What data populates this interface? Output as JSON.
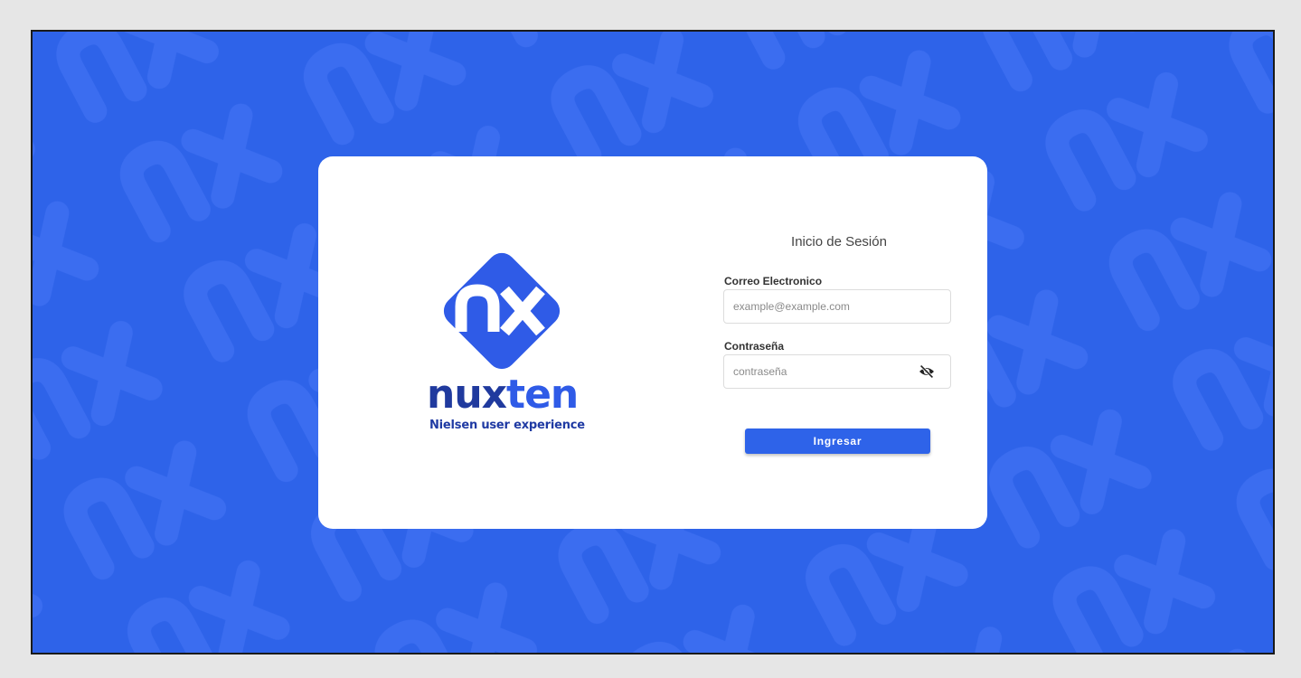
{
  "colors": {
    "background": "#2e63e9",
    "card": "#ffffff",
    "brand_dark": "#203a9e",
    "brand_light": "#2f5be7",
    "button": "#2e63e9"
  },
  "background_pattern": {
    "motif": "nx",
    "icon": "nx-watermark-pattern"
  },
  "brand": {
    "logo_icon": "nx-diamond-logo",
    "name_part1": "nux",
    "name_part2": "ten",
    "tagline": "Nielsen user experience"
  },
  "login": {
    "title": "Inicio de Sesión",
    "email": {
      "label": "Correo Electronico",
      "placeholder": "example@example.com",
      "value": ""
    },
    "password": {
      "label": "Contraseña",
      "placeholder": "contraseña",
      "value": "",
      "toggle_icon": "eye-slash-icon"
    },
    "submit_label": "Ingresar"
  }
}
